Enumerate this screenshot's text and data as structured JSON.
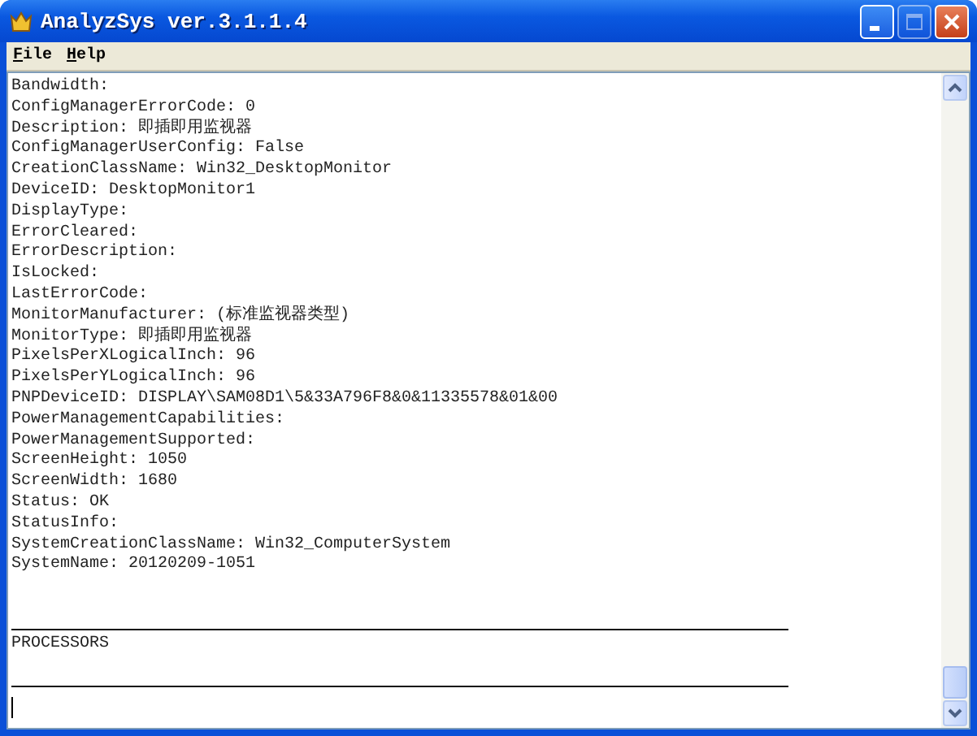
{
  "window": {
    "title": "AnalyzSys ver.3.1.1.4",
    "buttons": [
      {
        "kind": "minimize",
        "disabled": false
      },
      {
        "kind": "maximize",
        "disabled": true
      },
      {
        "kind": "close",
        "disabled": false
      }
    ]
  },
  "menu": [
    {
      "label": "File"
    },
    {
      "label": "Help"
    }
  ],
  "document": [
    {
      "kind": "text",
      "text": "Bandwidth:"
    },
    {
      "kind": "text",
      "text": "ConfigManagerErrorCode: 0"
    },
    {
      "kind": "text",
      "text": "Description: 即插即用监视器"
    },
    {
      "kind": "text",
      "text": "ConfigManagerUserConfig: False"
    },
    {
      "kind": "text",
      "text": "CreationClassName: Win32_DesktopMonitor"
    },
    {
      "kind": "text",
      "text": "DeviceID: DesktopMonitor1"
    },
    {
      "kind": "text",
      "text": "DisplayType:"
    },
    {
      "kind": "text",
      "text": "ErrorCleared:"
    },
    {
      "kind": "text",
      "text": "ErrorDescription:"
    },
    {
      "kind": "text",
      "text": "IsLocked:"
    },
    {
      "kind": "text",
      "text": "LastErrorCode:"
    },
    {
      "kind": "text",
      "text": "MonitorManufacturer: (标准监视器类型)"
    },
    {
      "kind": "text",
      "text": "MonitorType: 即插即用监视器"
    },
    {
      "kind": "text",
      "text": "PixelsPerXLogicalInch: 96"
    },
    {
      "kind": "text",
      "text": "PixelsPerYLogicalInch: 96"
    },
    {
      "kind": "text",
      "text": "PNPDeviceID: DISPLAY\\SAM08D1\\5&33A796F8&0&11335578&01&00"
    },
    {
      "kind": "text",
      "text": "PowerManagementCapabilities:"
    },
    {
      "kind": "text",
      "text": "PowerManagementSupported:"
    },
    {
      "kind": "text",
      "text": "ScreenHeight: 1050"
    },
    {
      "kind": "text",
      "text": "ScreenWidth: 1680"
    },
    {
      "kind": "text",
      "text": "Status: OK"
    },
    {
      "kind": "text",
      "text": "StatusInfo:"
    },
    {
      "kind": "text",
      "text": "SystemCreationClassName: Win32_ComputerSystem"
    },
    {
      "kind": "text",
      "text": "SystemName: 20120209-1051"
    },
    {
      "kind": "blank"
    },
    {
      "kind": "blank"
    },
    {
      "kind": "rule"
    },
    {
      "kind": "text",
      "text": "PROCESSORS"
    },
    {
      "kind": "blank"
    },
    {
      "kind": "rule"
    },
    {
      "kind": "caret"
    }
  ]
}
